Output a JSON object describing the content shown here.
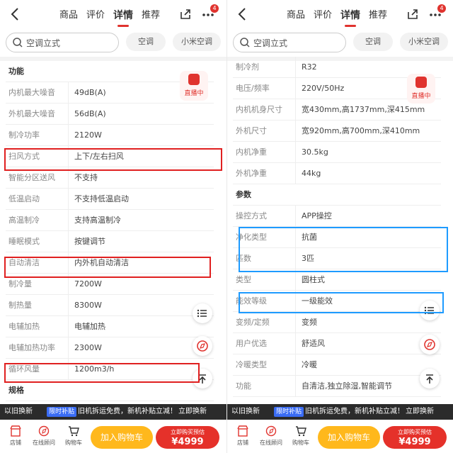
{
  "header": {
    "tabs": [
      "商品",
      "评价",
      "详情",
      "推荐"
    ],
    "active_tab": "详情",
    "badge": "4"
  },
  "search": {
    "value": "空调立式",
    "chips": [
      "空调",
      "小米空调"
    ]
  },
  "live": {
    "label": "直播中"
  },
  "left_panel": {
    "rows": [
      {
        "key": "功能",
        "value": "",
        "head": true
      },
      {
        "key": "内机最大噪音",
        "value": "49dB(A)"
      },
      {
        "key": "外机最大噪音",
        "value": "56dB(A)"
      },
      {
        "key": "制冷功率",
        "value": "2120W"
      },
      {
        "key": "扫风方式",
        "value": "上下/左右扫风"
      },
      {
        "key": "智能分区送风",
        "value": "不支持"
      },
      {
        "key": "低温启动",
        "value": "不支持低温启动"
      },
      {
        "key": "高温制冷",
        "value": "支持高温制冷"
      },
      {
        "key": "睡眠模式",
        "value": "按键调节"
      },
      {
        "key": "自动清洁",
        "value": "内外机自动清洁"
      },
      {
        "key": "制冷量",
        "value": "7200W"
      },
      {
        "key": "制热量",
        "value": "8300W"
      },
      {
        "key": "电辅加热",
        "value": "电辅加热"
      },
      {
        "key": "电辅加热功率",
        "value": "2300W"
      },
      {
        "key": "循环风量",
        "value": "1200m3/h"
      },
      {
        "key": "规格",
        "value": "",
        "head": true
      }
    ]
  },
  "right_panel": {
    "rows": [
      {
        "key": "制冷剂",
        "value": "R32"
      },
      {
        "key": "电压/频率",
        "value": "220V/50Hz"
      },
      {
        "key": "内机机身尺寸",
        "value": "宽430mm,高1737mm,深415mm"
      },
      {
        "key": "外机尺寸",
        "value": "宽920mm,高700mm,深410mm"
      },
      {
        "key": "内机净重",
        "value": "30.5kg"
      },
      {
        "key": "外机净重",
        "value": "44kg"
      },
      {
        "key": "参数",
        "value": "",
        "head": true
      },
      {
        "key": "操控方式",
        "value": "APP操控"
      },
      {
        "key": "净化类型",
        "value": "抗菌"
      },
      {
        "key": "匹数",
        "value": "3匹"
      },
      {
        "key": "类型",
        "value": "圆柱式"
      },
      {
        "key": "能效等级",
        "value": "一级能效"
      },
      {
        "key": "变频/定频",
        "value": "变频"
      },
      {
        "key": "用户优选",
        "value": "舒适风"
      },
      {
        "key": "冷暖类型",
        "value": "冷暖"
      },
      {
        "key": "功能",
        "value": "自清洁,独立除湿,智能调节"
      }
    ]
  },
  "promo": {
    "trade_in": "以旧换新",
    "tag": "限时补贴",
    "text": "旧机拆运免费，新机补贴立减！",
    "cta": "立即换新"
  },
  "bottom_bar": {
    "store": "店铺",
    "consult": "在线顾问",
    "cart": "购物车",
    "add_to_cart": "加入购物车",
    "buy_top": "立即购买预估",
    "price": "¥4999"
  },
  "colors": {
    "accent": "#e0332e",
    "red_highlight": "#e02020",
    "blue_highlight": "#1e9bff",
    "cart_button": "#ffb81c",
    "buy_button": "#e5312a"
  }
}
